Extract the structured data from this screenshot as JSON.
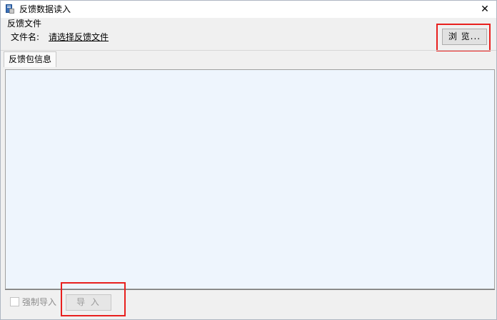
{
  "window": {
    "title": "反馈数据读入",
    "close_glyph": "✕"
  },
  "feedback_file": {
    "group_label": "反馈文件",
    "file_name_label": "文件名:",
    "file_link_text": "请选择反馈文件",
    "browse_button_label": "浏 览..."
  },
  "tabs": [
    {
      "label": "反馈包信息"
    }
  ],
  "footer": {
    "force_import_label": "强制导入",
    "force_import_checked": false,
    "import_button_label": "导 入"
  },
  "colors": {
    "highlight_border": "#e8201e",
    "panel_background": "#eef5fd",
    "window_background": "#f0f0f0"
  }
}
